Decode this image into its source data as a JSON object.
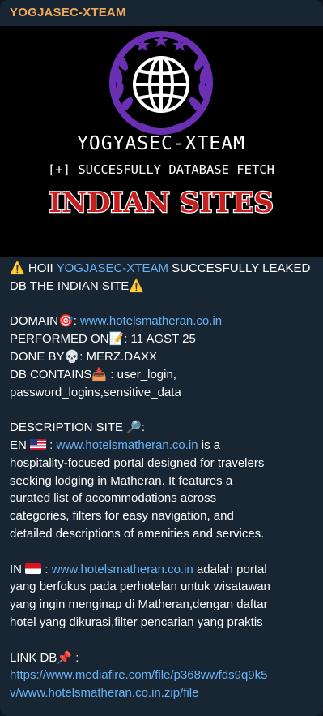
{
  "sender": "YOGJASEC-XTEAM",
  "banner": {
    "title": "YOGYASEC-XTEAM",
    "subtitle": "[+] SUCCESFULLY DATABASE FETCH",
    "headline": "INDIAN SITES"
  },
  "message": {
    "hoii": "HOII ",
    "group_link": "YOGJASEC-XTEAM",
    "leaked_text": " SUCCESFULLY LEAKED",
    "leaked_text2": "DB THE INDIAN SITE",
    "domain_label": "DOMAIN",
    "domain_sep": ": ",
    "domain_link": "www.hotelsmatheran.co.in",
    "performed_label": "PERFORMED ON",
    "performed_value": ": 11 AGST 25",
    "done_label": "DONE BY",
    "done_value": ": MERZ.DAXX",
    "db_label": "DB CONTAINS",
    "db_value": " : user_login,",
    "db_value2": "password_logins,sensitive_data",
    "desc_label": "DESCRIPTION SITE ",
    "desc_colon": ":",
    "en_label": "EN",
    "en_sep": " : ",
    "en_link": "www.hotelsmatheran.co.in",
    "en_text1": " is a",
    "en_text2": "hospitality-focused portal designed for travelers",
    "en_text3": "seeking lodging in Matheran. It features a",
    "en_text4": "curated list of accommodations across",
    "en_text5": "categories, filters for easy navigation, and",
    "en_text6": "detailed descriptions of amenities and services.",
    "in_label": "IN",
    "in_sep": " : ",
    "in_link": "www.hotelsmatheran.co.in",
    "in_text1": " adalah portal",
    "in_text2": "yang berfokus pada perhotelan untuk wisatawan",
    "in_text3": "yang ingin menginap di Matheran,dengan daftar",
    "in_text4": "hotel yang dikurasi,filter pencarian yang praktis",
    "linkdb_label": "LINK DB",
    "linkdb_colon": " :",
    "linkdb_url1": "https://www.mediafire.com/file/p368wwfds9q9k5",
    "linkdb_url2": "v/www.hotelsmatheran.co.in.zip/file"
  },
  "icons": [
    "warning-icon",
    "target-icon",
    "calendar-icon",
    "skull-icon",
    "inbox-tray-icon",
    "magnifier-icon",
    "us-flag-icon",
    "indonesia-flag-icon",
    "pushpin-icon"
  ],
  "colors": {
    "sender": "#f0a95a",
    "link": "#6ab3f3",
    "bubble": "#182533",
    "emblem_purple": "#6b2fb3",
    "headline_red": "#c81e1e"
  }
}
